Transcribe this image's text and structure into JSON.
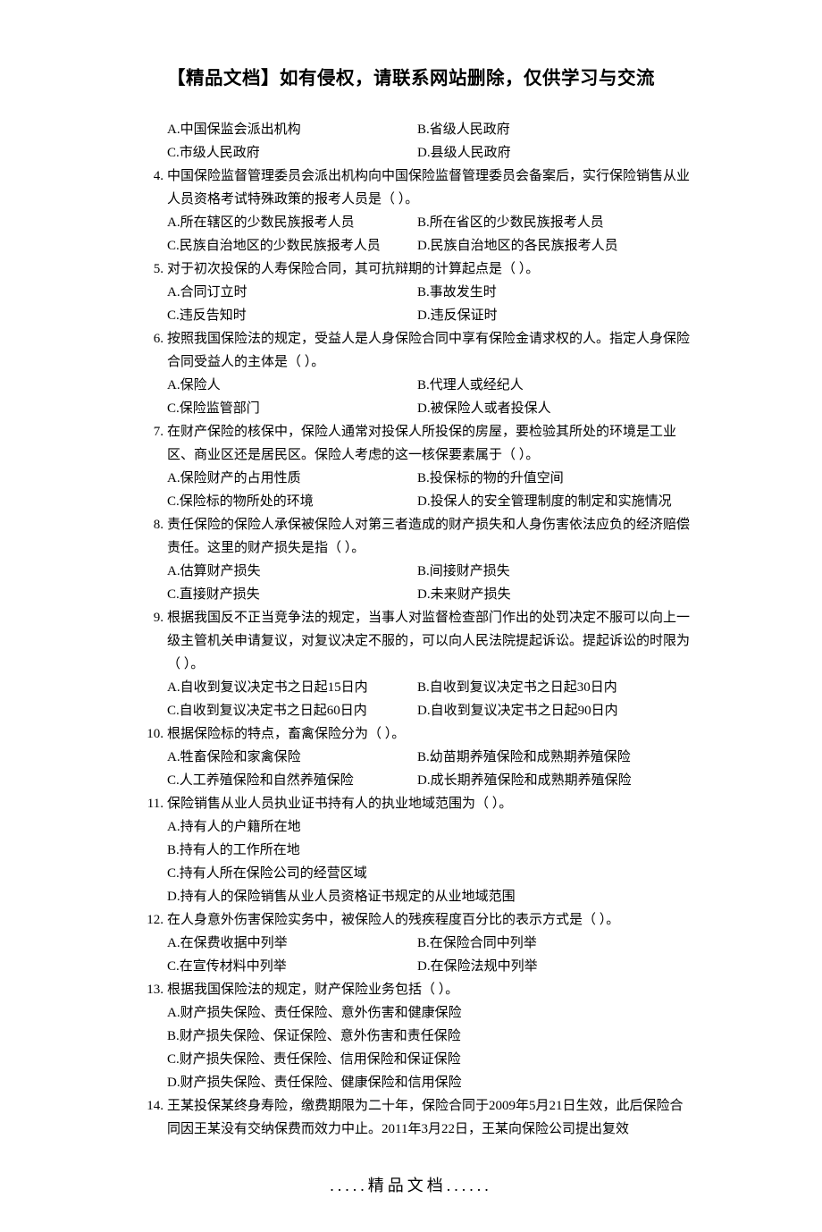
{
  "header": "【精品文档】如有侵权，请联系网站删除，仅供学习与交流",
  "footer": ".....精品文档......",
  "pre_opts": {
    "A": "A.中国保监会派出机构",
    "B": "B.省级人民政府",
    "C": "C.市级人民政府",
    "D": "D.县级人民政府"
  },
  "q4": {
    "num": "4.",
    "text": "中国保险监督管理委员会派出机构向中国保险监督管理委员会备案后，实行保险销售从业人员资格考试特殊政策的报考人员是（ ）。",
    "A": "A.所在辖区的少数民族报考人员",
    "B": "B.所在省区的少数民族报考人员",
    "C": "C.民族自治地区的少数民族报考人员",
    "D": "D.民族自治地区的各民族报考人员"
  },
  "q5": {
    "num": "5.",
    "text": "对于初次投保的人寿保险合同，其可抗辩期的计算起点是（ ）。",
    "A": "A.合同订立时",
    "B": "B.事故发生时",
    "C": "C.违反告知时",
    "D": "D.违反保证时"
  },
  "q6": {
    "num": "6.",
    "text": "按照我国保险法的规定，受益人是人身保险合同中享有保险金请求权的人。指定人身保险合同受益人的主体是（ ）。",
    "A": "A.保险人",
    "B": "B.代理人或经纪人",
    "C": "C.保险监管部门",
    "D": "D.被保险人或者投保人"
  },
  "q7": {
    "num": "7.",
    "text": "在财产保险的核保中，保险人通常对投保人所投保的房屋，要检验其所处的环境是工业区、商业区还是居民区。保险人考虑的这一核保要素属于（ ）。",
    "A": "A.保险财产的占用性质",
    "B": "B.投保标的物的升值空间",
    "C": "C.保险标的物所处的环境",
    "D": "D.投保人的安全管理制度的制定和实施情况"
  },
  "q8": {
    "num": "8.",
    "text": "责任保险的保险人承保被保险人对第三者造成的财产损失和人身伤害依法应负的经济赔偿责任。这里的财产损失是指（ ）。",
    "A": "A.估算财产损失",
    "B": "B.间接财产损失",
    "C": "C.直接财产损失",
    "D": "D.未来财产损失"
  },
  "q9": {
    "num": "9.",
    "text": "根据我国反不正当竞争法的规定，当事人对监督检查部门作出的处罚决定不服可以向上一级主管机关申请复议，对复议决定不服的，可以向人民法院提起诉讼。提起诉讼的时限为（ ）。",
    "A": "A.自收到复议决定书之日起15日内",
    "B": "B.自收到复议决定书之日起30日内",
    "C": "C.自收到复议决定书之日起60日内",
    "D": "D.自收到复议决定书之日起90日内"
  },
  "q10": {
    "num": "10.",
    "text": "根据保险标的特点，畜禽保险分为（ ）。",
    "A": "A.牲畜保险和家禽保险",
    "B": "B.幼苗期养殖保险和成熟期养殖保险",
    "C": "C.人工养殖保险和自然养殖保险",
    "D": "D.成长期养殖保险和成熟期养殖保险"
  },
  "q11": {
    "num": "11.",
    "text": "保险销售从业人员执业证书持有人的执业地域范围为（ ）。",
    "A": "A.持有人的户籍所在地",
    "B": "B.持有人的工作所在地",
    "C": "C.持有人所在保险公司的经营区域",
    "D": "D.持有人的保险销售从业人员资格证书规定的从业地域范围"
  },
  "q12": {
    "num": "12.",
    "text": "在人身意外伤害保险实务中，被保险人的残疾程度百分比的表示方式是（ ）。",
    "A": "A.在保费收据中列举",
    "B": "B.在保险合同中列举",
    "C": "C.在宣传材料中列举",
    "D": "D.在保险法规中列举"
  },
  "q13": {
    "num": "13.",
    "text": "根据我国保险法的规定，财产保险业务包括（ ）。",
    "A": "A.财产损失保险、责任保险、意外伤害和健康保险",
    "B": "B.财产损失保险、保证保险、意外伤害和责任保险",
    "C": "C.财产损失保险、责任保险、信用保险和保证保险",
    "D": "D.财产损失保险、责任保险、健康保险和信用保险"
  },
  "q14": {
    "num": "14.",
    "text": "王某投保某终身寿险，缴费期限为二十年，保险合同于2009年5月21日生效，此后保险合同因王某没有交纳保费而效力中止。2011年3月22日，王某向保险公司提出复效"
  }
}
